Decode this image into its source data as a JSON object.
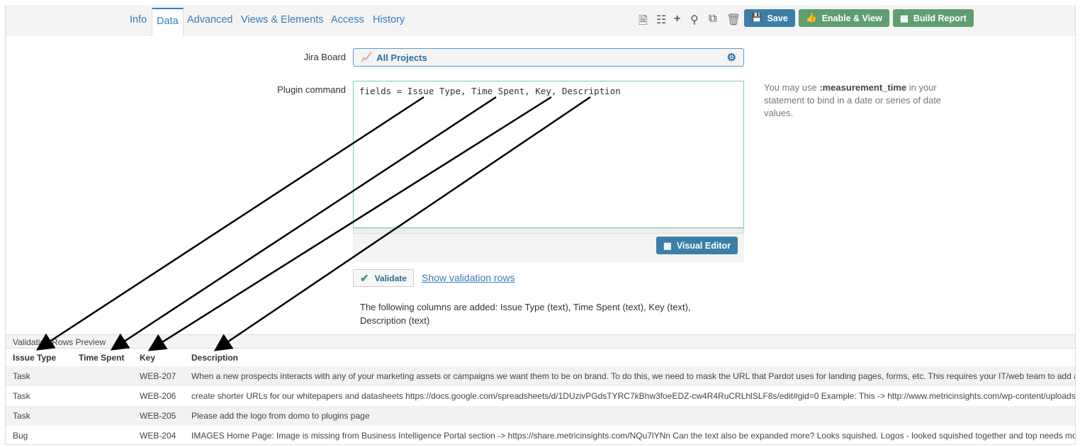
{
  "tabs": [
    "Info",
    "Data",
    "Advanced",
    "Views & Elements",
    "Access",
    "History"
  ],
  "active_tab": "Data",
  "toolbar": {
    "save": "Save",
    "enable_view": "Enable & View",
    "build_report": "Build Report"
  },
  "form": {
    "jira_board_label": "Jira Board",
    "jira_board_value": "All Projects",
    "plugin_command_label": "Plugin command",
    "plugin_command_value": "fields = Issue Type, Time Spent, Key, Description",
    "visual_editor": "Visual Editor",
    "help_pre": "You may use ",
    "help_bold": ":measurement_time",
    "help_post": " in your statement to bind in a date or series of date values.",
    "validate": "Validate",
    "show_validation_rows": "Show validation rows",
    "columns_added": "The following columns are added: Issue Type (text), Time Spent (text), Key (text), Description (text)"
  },
  "preview": {
    "title": "Validation Rows Preview",
    "headers": [
      "Issue Type",
      "Time Spent",
      "Key",
      "Description"
    ],
    "rows": [
      [
        "Task",
        "",
        "WEB-207",
        "When a new prospects interacts with any of your marketing assets or campaigns we want them to be on brand. To do this, we need to mask the URL that Pardot uses for landing pages, forms, etc. This requires your IT/web team to add a"
      ],
      [
        "Task",
        "",
        "WEB-206",
        "create shorter URLs for our whitepapers and datasheets https://docs.google.com/spreadsheets/d/1DUzivPGdsTYRC7kBhw3foeEDZ-cw4R4RuCRLhlSLF8s/edit#gid=0 Example: This -> http://www.metricinsights.com/wp-content/uploads"
      ],
      [
        "Task",
        "",
        "WEB-205",
        "Please add the logo from domo to plugins page"
      ],
      [
        "Bug",
        "",
        "WEB-204",
        "IMAGES Home Page: Image is missing from Business Intelligence Portal section -> https://share.metricinsights.com/NQu7lYNn Can the text also be expanded more? Looks squished. Logos - looked squished together and top needs mo"
      ]
    ]
  },
  "colors": {
    "accent": "#3a7cb8",
    "save": "#3b7fa6",
    "green": "#5f9e6f"
  }
}
